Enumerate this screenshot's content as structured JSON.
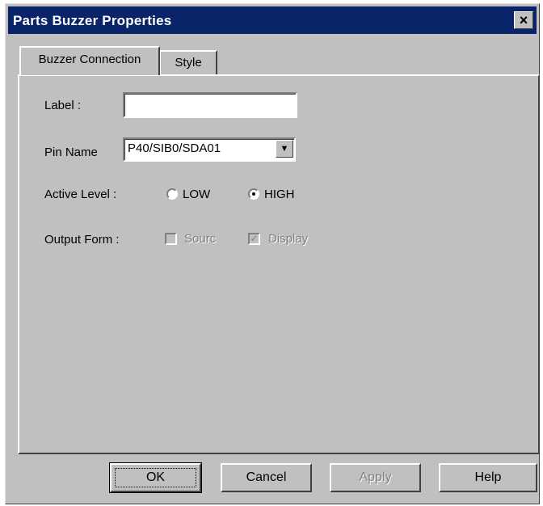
{
  "window": {
    "title": "Parts Buzzer Properties",
    "close_glyph": "×"
  },
  "tabs": [
    {
      "label": "Buzzer Connection",
      "active": true
    },
    {
      "label": "Style",
      "active": false
    }
  ],
  "form": {
    "label_caption": "Label :",
    "label_value": "",
    "pin_caption": "Pin Name",
    "pin_value": "P40/SIB0/SDA01",
    "active_level_caption": "Active Level :",
    "active_level_options": [
      {
        "label": "LOW",
        "selected": false
      },
      {
        "label": "HIGH",
        "selected": true
      }
    ],
    "output_form_caption": "Output Form :",
    "output_form_options": [
      {
        "label": "Sourc",
        "checked": false,
        "disabled": true
      },
      {
        "label": "Display",
        "checked": true,
        "disabled": true
      }
    ]
  },
  "buttons": {
    "ok": "OK",
    "cancel": "Cancel",
    "apply": "Apply",
    "help": "Help"
  },
  "icons": {
    "dropdown": "▼",
    "check": "✓"
  },
  "colors": {
    "titlebar": "#0a246a",
    "face": "#c0c0c0"
  }
}
